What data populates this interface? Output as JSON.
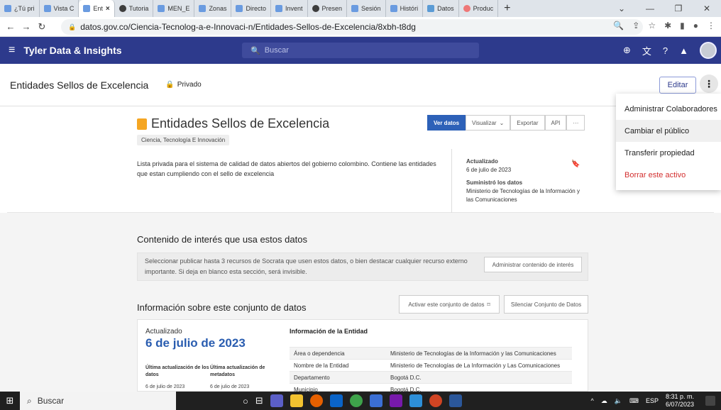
{
  "browser": {
    "tabs": [
      {
        "label": "¿Tú pri",
        "icon": "socrata-icon"
      },
      {
        "label": "Vista C",
        "icon": "socrata-icon"
      },
      {
        "label": "Ent",
        "icon": "socrata-icon",
        "active": true
      },
      {
        "label": "Tutoria",
        "icon": "github-icon"
      },
      {
        "label": "MEN_E",
        "icon": "socrata-icon"
      },
      {
        "label": "Zonas",
        "icon": "socrata-icon"
      },
      {
        "label": "Directo",
        "icon": "socrata-icon"
      },
      {
        "label": "Invent",
        "icon": "socrata-icon"
      },
      {
        "label": "Presen",
        "icon": "github-icon"
      },
      {
        "label": "Sesión",
        "icon": "socrata-icon"
      },
      {
        "label": "Históri",
        "icon": "socrata-icon"
      },
      {
        "label": "Datos",
        "icon": "datos-icon"
      },
      {
        "label": "Produc",
        "icon": "chrome-icon"
      }
    ],
    "url": "datos.gov.co/Ciencia-Tecnolog-a-e-Innovaci-n/Entidades-Sellos-de-Excelencia/8xbh-t8dg"
  },
  "appbar": {
    "name": "Tyler Data & Insights",
    "search_placeholder": "Buscar"
  },
  "topbar": {
    "title": "Entidades Sellos de Excelencia",
    "privacy": "Privado",
    "edit_label": "Editar"
  },
  "menu": {
    "items": [
      "Administrar Colaboradores",
      "Cambiar el público",
      "Transferir propiedad",
      "Borrar este activo"
    ]
  },
  "hero": {
    "title": "Entidades Sellos de Excelencia",
    "category": "Ciencia, Tecnología E Innovación",
    "buttons": {
      "view": "Ver datos",
      "visualize": "Visualizar",
      "export": "Exportar",
      "api": "API",
      "more": "···"
    },
    "description": "Lista privada para el sistema de calidad de datos abiertos del gobierno colombino. Contiene las entidades que estan cumpliendo con el sello de excelencia",
    "updated_label": "Actualizado",
    "updated_value": "6 de julio de 2023",
    "provided_label": "Suministró los datos",
    "provided_value": "Ministerio de Tecnologías de la Información y las Comunicaciones"
  },
  "interest": {
    "title": "Contenido de interés que usa estos datos",
    "text": "Seleccionar publicar hasta 3 recursos de Socrata que usen estos datos, o bien destacar cualquier recurso externo importante. Si deja en blanco esta sección, será invisible.",
    "admin_button": "Administrar contenido de interés"
  },
  "dataset": {
    "title": "Información sobre este conjunto de datos",
    "activate_button": "Activar este conjunto de datos",
    "silence_button": "Silenciar Conjunto de Datos",
    "updated_label": "Actualizado",
    "updated_date": "6 de julio de 2023",
    "last_data_label": "Última actualización de los datos",
    "last_data_value": "6 de julio de 2023",
    "last_meta_label": "Última actualización de metadatos",
    "last_meta_value": "6 de julio de 2023",
    "entity_title": "Información de la Entidad",
    "entity_rows": [
      {
        "key": "Área o dependencia",
        "value": "Ministerio de Tecnologías de la Información y las Comunicaciones"
      },
      {
        "key": "Nombre de la Entidad",
        "value": "Ministerio de Tecnologías de La Información y Las Comunicaciones"
      },
      {
        "key": "Departamento",
        "value": "Bogotá D.C."
      },
      {
        "key": "Municipio",
        "value": "Bogotá D.C."
      }
    ]
  },
  "taskbar": {
    "search": "Buscar",
    "lang": "ESP",
    "time": "8:31 p. m.",
    "date": "6/07/2023"
  }
}
